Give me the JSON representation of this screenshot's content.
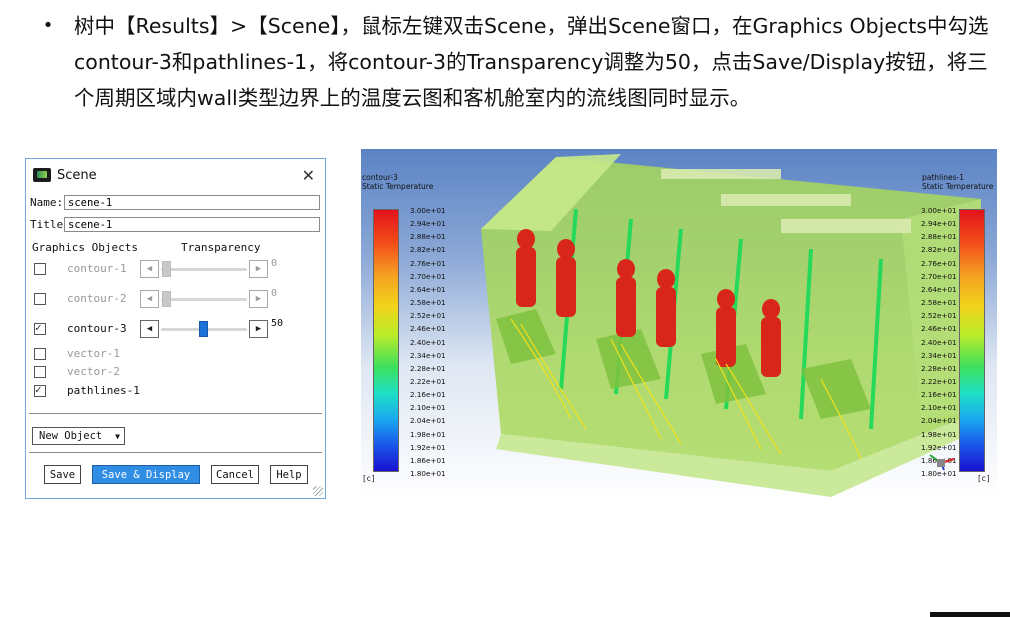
{
  "instruction": {
    "bullet": "•",
    "text": "树中【Results】>【Scene】，鼠标左键双击Scene，弹出Scene窗口，在Graphics Objects中勾选contour-3和pathlines-1，将contour-3的Transparency调整为50，点击Save/Display按钮，将三个周期区域内wall类型边界上的温度云图和客机舱室内的流线图同时显示。"
  },
  "dialog": {
    "title": "Scene",
    "name_label": "Name:",
    "name_value": "scene-1",
    "title_label": "Title:",
    "title_value": "scene-1",
    "graphics_objects_header": "Graphics Objects",
    "transparency_header": "Transparency",
    "objects": [
      {
        "label": "contour-1",
        "checked": false,
        "enabled": false,
        "transparency": "0"
      },
      {
        "label": "contour-2",
        "checked": false,
        "enabled": false,
        "transparency": "0"
      },
      {
        "label": "contour-3",
        "checked": true,
        "enabled": true,
        "transparency": "50"
      },
      {
        "label": "vector-1",
        "checked": false,
        "enabled": false
      },
      {
        "label": "vector-2",
        "checked": false,
        "enabled": false
      },
      {
        "label": "pathlines-1",
        "checked": true,
        "enabled": true
      }
    ],
    "new_object": "New Object",
    "buttons": {
      "save": "Save",
      "save_display": "Save & Display",
      "cancel": "Cancel",
      "help": "Help"
    }
  },
  "viz": {
    "left_legend": {
      "title": "contour-3",
      "subtitle": "Static Temperature",
      "unit": "[c]"
    },
    "right_legend": {
      "title": "pathlines-1",
      "subtitle": "Static Temperature",
      "unit": "[c]"
    },
    "ticks": [
      "3.00e+01",
      "2.94e+01",
      "2.88e+01",
      "2.82e+01",
      "2.76e+01",
      "2.70e+01",
      "2.64e+01",
      "2.58e+01",
      "2.52e+01",
      "2.46e+01",
      "2.40e+01",
      "2.34e+01",
      "2.28e+01",
      "2.22e+01",
      "2.16e+01",
      "2.10e+01",
      "2.04e+01",
      "1.98e+01",
      "1.92e+01",
      "1.86e+01",
      "1.80e+01"
    ],
    "colors": {
      "hot": "#e3121b",
      "cold": "#1810d0",
      "shell": "#9ed34a"
    }
  }
}
